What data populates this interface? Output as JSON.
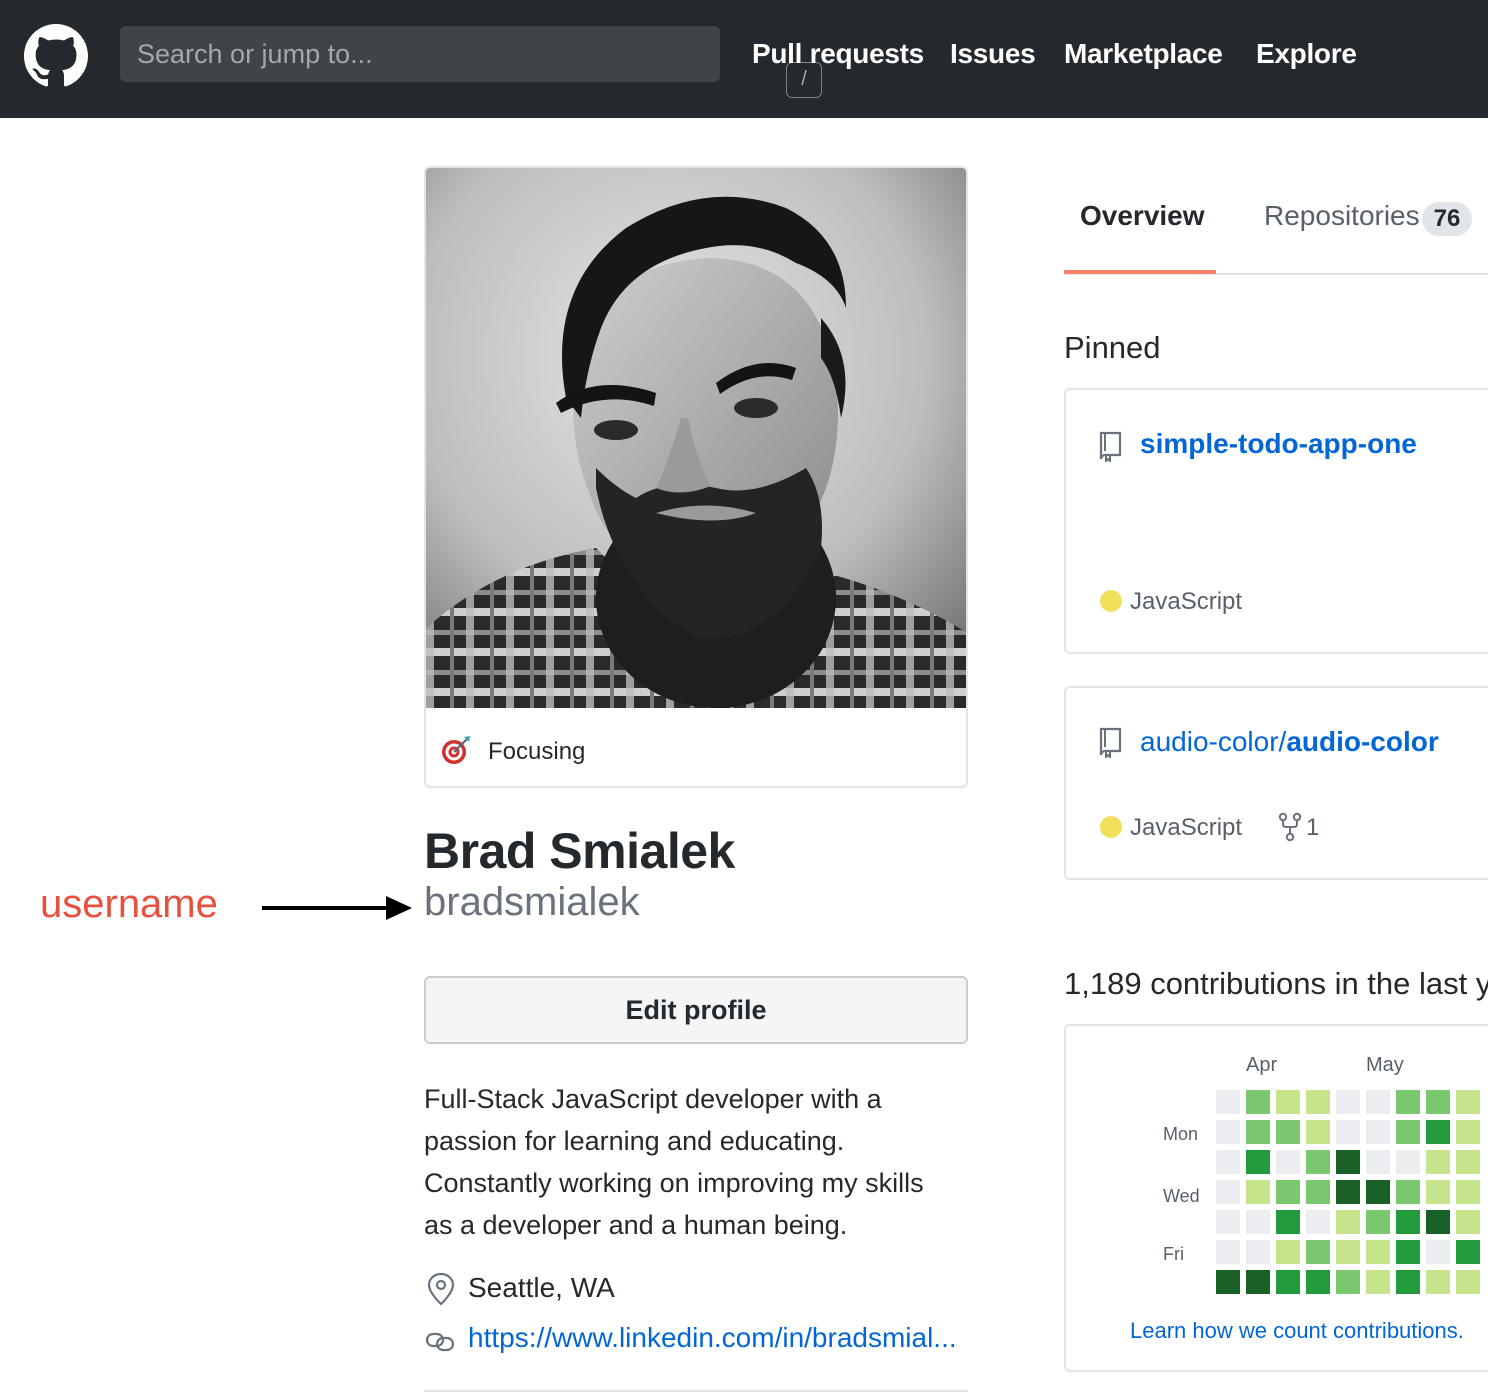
{
  "header": {
    "search_placeholder": "Search or jump to...",
    "search_shortcut": "/",
    "nav": [
      "Pull requests",
      "Issues",
      "Marketplace",
      "Explore"
    ]
  },
  "profile": {
    "status_emoji": "direct-hit-icon",
    "status": "Focusing",
    "full_name": "Brad Smialek",
    "username": "bradsmialek",
    "edit_button": "Edit profile",
    "bio_lines": [
      "Full-Stack JavaScript developer with a",
      "passion for learning and educating.",
      "Constantly working on improving my skills",
      "as a developer and a human being."
    ],
    "location": "Seattle, WA",
    "website": "https://www.linkedin.com/in/bradsmial..."
  },
  "annotation": {
    "label": "username"
  },
  "tabs": [
    {
      "label": "Overview",
      "selected": true
    },
    {
      "label": "Repositories",
      "count": "76",
      "selected": false
    }
  ],
  "pinned": {
    "title": "Pinned",
    "repos": [
      {
        "owner": "",
        "name": "simple-todo-app-one",
        "language": "JavaScript",
        "language_color": "#f1e05a",
        "forks": ""
      },
      {
        "owner": "audio-color/",
        "name": "audio-color",
        "language": "JavaScript",
        "language_color": "#f1e05a",
        "forks": "1"
      }
    ]
  },
  "contributions": {
    "title": "1,189 contributions in the last y",
    "months": [
      "Apr",
      "May"
    ],
    "days": [
      "Mon",
      "Wed",
      "Fri"
    ],
    "levels": [
      [
        0,
        0,
        0,
        0,
        0,
        0,
        4
      ],
      [
        2,
        2,
        3,
        1,
        0,
        0,
        4
      ],
      [
        1,
        2,
        0,
        2,
        3,
        1,
        3
      ],
      [
        1,
        1,
        2,
        2,
        0,
        2,
        3
      ],
      [
        0,
        0,
        4,
        4,
        1,
        1,
        2
      ],
      [
        0,
        0,
        0,
        4,
        2,
        1,
        1
      ],
      [
        2,
        2,
        0,
        2,
        3,
        3,
        3
      ],
      [
        2,
        3,
        1,
        1,
        4,
        0,
        1
      ],
      [
        1,
        1,
        1,
        1,
        1,
        3,
        1
      ]
    ],
    "level_colors": [
      "#ebedf0",
      "#c6e48b",
      "#7bc96f",
      "#239a3b",
      "#196127"
    ],
    "learn_link": "Learn how we count contributions."
  }
}
